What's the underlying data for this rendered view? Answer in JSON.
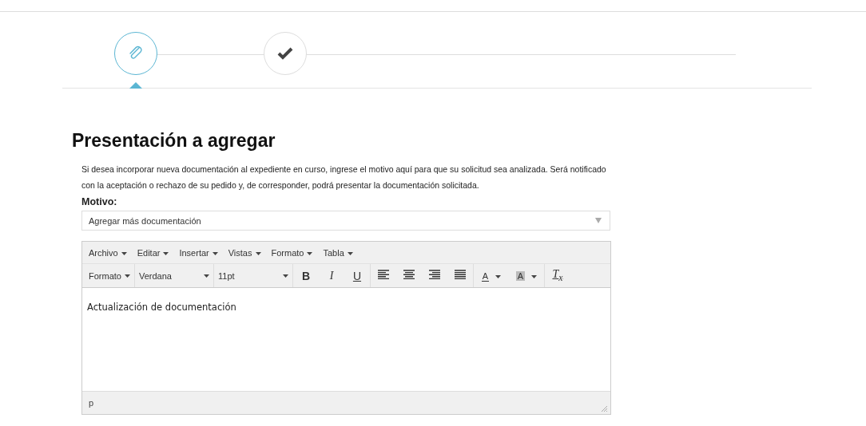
{
  "steps": [
    {
      "kind": "attach",
      "selected": true
    },
    {
      "kind": "check",
      "selected": false
    }
  ],
  "title": "Presentación a agregar",
  "description": "Si desea incorporar nueva documentación al expediente en curso, ingrese el motivo aquí para que su solicitud sea analizada. Será notificado con la aceptación o rechazo de su pedido y, de corresponder, podrá presentar la documentación solicitada.",
  "motivo": {
    "label": "Motivo:",
    "value": "Agregar más documentación"
  },
  "editor": {
    "menu": [
      "Archivo",
      "Editar",
      "Insertar",
      "Vistas",
      "Formato",
      "Tabla"
    ],
    "toolbar": [
      {
        "kind": "dropdown",
        "label": "Formato"
      },
      {
        "kind": "dropdown",
        "label": "Verdana",
        "wide": true
      },
      {
        "kind": "dropdown",
        "label": "11pt",
        "wide": true
      },
      {
        "kind": "bold",
        "label": "B"
      },
      {
        "kind": "italic",
        "label": "I"
      },
      {
        "kind": "underline",
        "label": "U"
      },
      {
        "kind": "align-left"
      },
      {
        "kind": "align-center"
      },
      {
        "kind": "align-right"
      },
      {
        "kind": "align-justify"
      },
      {
        "kind": "color",
        "label": "A",
        "background": false
      },
      {
        "kind": "color",
        "label": "A",
        "background": true
      },
      {
        "kind": "clear",
        "label": "T$_{x}$"
      }
    ],
    "content": "Actualización de documentación",
    "path": "p"
  }
}
